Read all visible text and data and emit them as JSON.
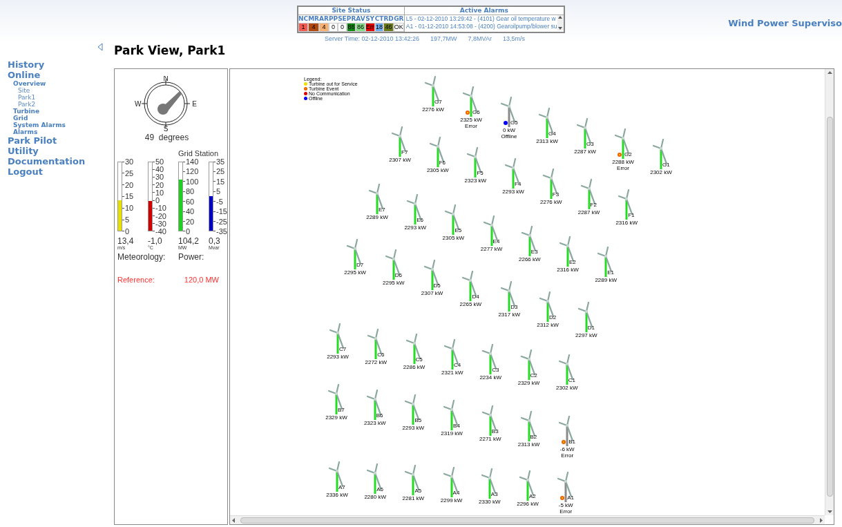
{
  "brand": "Wind Power Superviso",
  "site_status": {
    "title": "Site Status",
    "codes": [
      {
        "label": "NC",
        "value": "1",
        "color": "#f05a50"
      },
      {
        "label": "MR",
        "value": "4",
        "color": "#b04810"
      },
      {
        "label": "AR",
        "value": "4",
        "color": "#f8b070"
      },
      {
        "label": "PP",
        "value": "0",
        "color": "#ffffff"
      },
      {
        "label": "SE",
        "value": "0",
        "color": "#ffffff"
      },
      {
        "label": "PR",
        "value": "86",
        "color": "#108a10"
      },
      {
        "label": "AV",
        "value": "86",
        "color": "#88dd88"
      },
      {
        "label": "SY",
        "value": "Err",
        "color": "#e00000"
      },
      {
        "label": "CT",
        "value": "18",
        "color": "#70aef0"
      },
      {
        "label": "RD",
        "value": "46",
        "color": "#6a7a18"
      },
      {
        "label": "GR",
        "value": "OK",
        "color": "#ffffff"
      }
    ]
  },
  "active_alarms": {
    "title": "Active Alarms",
    "items": [
      "L5 - 02-12-2010 13:29:42 - (4101) Gear oil temperature w",
      "A1 - 01-12-2010 14:53:08 - (4200) Gearoilpump/blower su"
    ]
  },
  "server_info": [
    "Server Time: 02-12-2010 13:42:26",
    "197,7MW",
    "7,8MVAr",
    "13,5m/s"
  ],
  "nav": [
    {
      "label": "History"
    },
    {
      "label": "Online",
      "children": [
        {
          "label": "Overview",
          "children": [
            {
              "label": "Site"
            },
            {
              "label": "Park1"
            },
            {
              "label": "Park2"
            }
          ]
        },
        {
          "label": "Turbine"
        },
        {
          "label": "Grid"
        },
        {
          "label": "System Alarms"
        },
        {
          "label": "Alarms"
        }
      ]
    },
    {
      "label": "Park Pilot"
    },
    {
      "label": "Utility"
    },
    {
      "label": "Documentation"
    },
    {
      "label": "Logout"
    }
  ],
  "page_title": "Park View, Park1",
  "compass": {
    "north": "N",
    "east": "E",
    "south": "S",
    "west": "W",
    "reading": "49  degrees"
  },
  "meteorology": {
    "label": "Meteorology:",
    "gauges": [
      {
        "value": "13,4",
        "unit": "m/s",
        "level": 0.447,
        "color": "#e8e000",
        "ticks": [
          "30",
          "25",
          "20",
          "15",
          "10",
          "5",
          "0"
        ]
      },
      {
        "value": "-1,0",
        "unit": "°C",
        "level": 0.433,
        "color": "#d00000",
        "ticks": [
          "50",
          "40",
          "30",
          "20",
          "10",
          "0",
          "-10",
          "-20",
          "-30",
          "-40"
        ]
      }
    ]
  },
  "power": {
    "title": "Grid Station",
    "label": "Power:",
    "gauges": [
      {
        "value": "104,2",
        "unit": "MW",
        "level": 0.744,
        "color": "#20d020",
        "ticks": [
          "140",
          "120",
          "100",
          "80",
          "60",
          "40",
          "20",
          "0"
        ]
      },
      {
        "value": "0,3",
        "unit": "Mvar",
        "level": 0.504,
        "color": "#0000c0",
        "ticks": [
          "35",
          "25",
          "15",
          "5",
          "-5",
          "-15",
          "-25",
          "-35"
        ]
      }
    ]
  },
  "reference": {
    "label": "Reference:",
    "value": "120,0 MW"
  },
  "legend": {
    "title": "Legend:",
    "items": [
      {
        "label": "Turbine out for Service",
        "kind": "service"
      },
      {
        "label": "Turbine Event",
        "kind": "event"
      },
      {
        "label": "No Communication",
        "kind": "nocomm"
      },
      {
        "label": "Offline",
        "kind": "offline"
      }
    ]
  },
  "rows": [
    {
      "turbines": [
        {
          "id": "G7",
          "power": "2276 kW",
          "running": true,
          "kind": "normal"
        },
        {
          "id": "G6",
          "power": "2325 kW",
          "running": true,
          "kind": "event",
          "note": "Error"
        },
        {
          "id": "G5",
          "power": "0 kW",
          "running": false,
          "kind": "offline",
          "note": "Offline"
        },
        {
          "id": "G4",
          "power": "2313 kW",
          "running": true,
          "kind": "normal"
        },
        {
          "id": "G3",
          "power": "2287 kW",
          "running": true,
          "kind": "normal"
        },
        {
          "id": "G2",
          "power": "2288 kW",
          "running": true,
          "kind": "event",
          "note": "Error"
        },
        {
          "id": "G1",
          "power": "2302 kW",
          "running": true,
          "kind": "normal"
        }
      ]
    },
    {
      "turbines": [
        {
          "id": "F7",
          "power": "2307 kW",
          "running": true,
          "kind": "normal"
        },
        {
          "id": "F6",
          "power": "2305 kW",
          "running": true,
          "kind": "normal"
        },
        {
          "id": "F5",
          "power": "2323 kW",
          "running": true,
          "kind": "normal"
        },
        {
          "id": "F4",
          "power": "2293 kW",
          "running": true,
          "kind": "normal"
        },
        {
          "id": "F3",
          "power": "2276 kW",
          "running": true,
          "kind": "normal"
        },
        {
          "id": "F2",
          "power": "2287 kW",
          "running": true,
          "kind": "normal"
        },
        {
          "id": "F1",
          "power": "2316 kW",
          "running": true,
          "kind": "normal"
        }
      ]
    },
    {
      "turbines": [
        {
          "id": "E7",
          "power": "2289 kW",
          "running": true,
          "kind": "normal"
        },
        {
          "id": "E6",
          "power": "2293 kW",
          "running": true,
          "kind": "normal"
        },
        {
          "id": "E5",
          "power": "2305 kW",
          "running": true,
          "kind": "normal"
        },
        {
          "id": "E4",
          "power": "2277 kW",
          "running": true,
          "kind": "normal"
        },
        {
          "id": "E3",
          "power": "2266 kW",
          "running": true,
          "kind": "normal"
        },
        {
          "id": "E2",
          "power": "2316 kW",
          "running": true,
          "kind": "normal"
        },
        {
          "id": "E1",
          "power": "2289 kW",
          "running": true,
          "kind": "normal"
        }
      ]
    },
    {
      "turbines": [
        {
          "id": "D7",
          "power": "2295 kW",
          "running": true,
          "kind": "normal"
        },
        {
          "id": "D6",
          "power": "2295 kW",
          "running": true,
          "kind": "normal"
        },
        {
          "id": "D5",
          "power": "2307 kW",
          "running": true,
          "kind": "normal"
        },
        {
          "id": "D4",
          "power": "2265 kW",
          "running": true,
          "kind": "normal"
        },
        {
          "id": "D3",
          "power": "2317 kW",
          "running": true,
          "kind": "normal"
        },
        {
          "id": "D2",
          "power": "2312 kW",
          "running": true,
          "kind": "normal"
        },
        {
          "id": "D1",
          "power": "2297 kW",
          "running": true,
          "kind": "normal"
        }
      ]
    },
    {
      "turbines": [
        {
          "id": "C7",
          "power": "2293 kW",
          "running": true,
          "kind": "normal"
        },
        {
          "id": "C6",
          "power": "2272 kW",
          "running": true,
          "kind": "normal"
        },
        {
          "id": "C5",
          "power": "2286 kW",
          "running": true,
          "kind": "normal"
        },
        {
          "id": "C4",
          "power": "2321 kW",
          "running": true,
          "kind": "normal"
        },
        {
          "id": "C3",
          "power": "2234 kW",
          "running": true,
          "kind": "normal"
        },
        {
          "id": "C2",
          "power": "2329 kW",
          "running": true,
          "kind": "normal"
        },
        {
          "id": "C1",
          "power": "2302 kW",
          "running": true,
          "kind": "normal"
        }
      ]
    },
    {
      "turbines": [
        {
          "id": "B7",
          "power": "2329 kW",
          "running": true,
          "kind": "normal"
        },
        {
          "id": "B6",
          "power": "2323 kW",
          "running": true,
          "kind": "normal"
        },
        {
          "id": "B5",
          "power": "2293 kW",
          "running": true,
          "kind": "normal"
        },
        {
          "id": "B4",
          "power": "2319 kW",
          "running": true,
          "kind": "normal"
        },
        {
          "id": "B3",
          "power": "2271 kW",
          "running": true,
          "kind": "normal"
        },
        {
          "id": "B2",
          "power": "2313 kW",
          "running": true,
          "kind": "normal"
        },
        {
          "id": "B1",
          "power": "-6 kW",
          "running": false,
          "kind": "event",
          "note": "Error"
        }
      ]
    },
    {
      "turbines": [
        {
          "id": "A7",
          "power": "2336 kW",
          "running": true,
          "kind": "normal"
        },
        {
          "id": "A6",
          "power": "2280 kW",
          "running": true,
          "kind": "normal"
        },
        {
          "id": "A5",
          "power": "2281 kW",
          "running": true,
          "kind": "normal"
        },
        {
          "id": "A4",
          "power": "2299 kW",
          "running": true,
          "kind": "normal"
        },
        {
          "id": "A3",
          "power": "2330 kW",
          "running": true,
          "kind": "normal"
        },
        {
          "id": "A2",
          "power": "2296 kW",
          "running": true,
          "kind": "normal"
        },
        {
          "id": "A1",
          "power": "-5 kW",
          "running": false,
          "kind": "event",
          "note": "Error"
        }
      ]
    }
  ]
}
